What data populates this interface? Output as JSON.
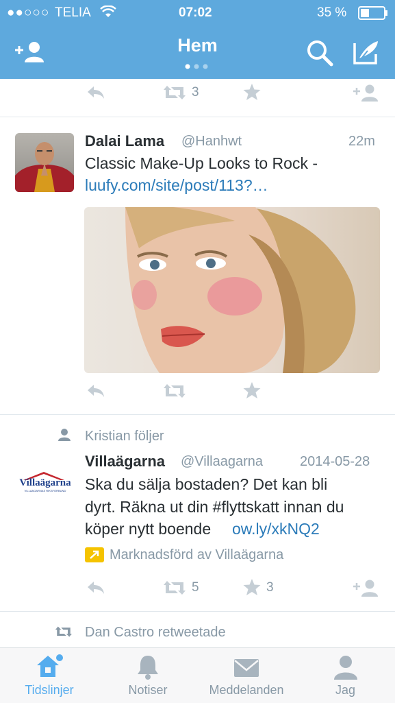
{
  "status_bar": {
    "carrier": "TELIA",
    "time": "07:02",
    "battery": "35 %"
  },
  "header": {
    "title": "Hem",
    "add_user_icon": "add-user-icon",
    "search_icon": "search-icon",
    "compose_icon": "compose-icon"
  },
  "tweet0": {
    "retweets": "3"
  },
  "tweet1": {
    "name": "Dalai Lama",
    "handle": "@Hanhwt",
    "time": "22m",
    "text": "Classic Make-Up Looks to Rock -",
    "link": "luufy.com/site/post/113?…"
  },
  "tweet2": {
    "context": "Kristian följer",
    "name": "Villaägarna",
    "handle": "@Villaagarna",
    "time": "2014-05-28",
    "text_line1": "Ska du sälja bostaden? Det kan bli",
    "text_line2": "dyrt. Räkna ut din #flyttskatt innan du",
    "text_line3": "köper nytt boende",
    "link": "ow.ly/xkNQ2",
    "promoted": "Marknadsförd av Villaägarna",
    "logo_text": "Villaägarna",
    "logo_sub": "VILLAÄGARNAS RIKSFÖRBUND",
    "retweets": "5",
    "favorites": "3"
  },
  "tweet3": {
    "context": "Dan Castro retweetade"
  },
  "tabs": [
    {
      "label": "Tidslinjer",
      "icon": "home-icon"
    },
    {
      "label": "Notiser",
      "icon": "bell-icon"
    },
    {
      "label": "Meddelanden",
      "icon": "envelope-icon"
    },
    {
      "label": "Jag",
      "icon": "person-icon"
    }
  ],
  "colors": {
    "header": "#5ea9dd",
    "link": "#2b7bb9",
    "muted": "#8899a6",
    "active_tab": "#55acee",
    "promoted": "#f5c300"
  }
}
